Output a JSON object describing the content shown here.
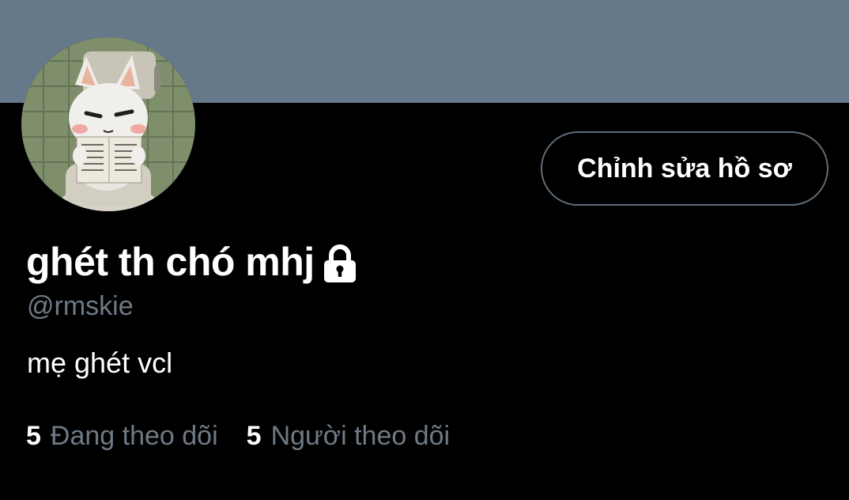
{
  "colors": {
    "banner": "#66798a",
    "background": "#000000",
    "text_primary": "#ffffff",
    "text_secondary": "#6e7a86",
    "button_border": "#5f6d7a"
  },
  "profile": {
    "display_name": "ghét th chó mhj",
    "protected_icon": "lock-icon",
    "handle": "@rmskie",
    "bio": "mẹ ghét vcl",
    "avatar_description": "white cat character reading a newspaper on a toilet"
  },
  "actions": {
    "edit_profile_label": "Chỉnh sửa hồ sơ"
  },
  "stats": {
    "following": {
      "count": "5",
      "label": "Đang theo dõi"
    },
    "followers": {
      "count": "5",
      "label": "Người theo dõi"
    }
  }
}
